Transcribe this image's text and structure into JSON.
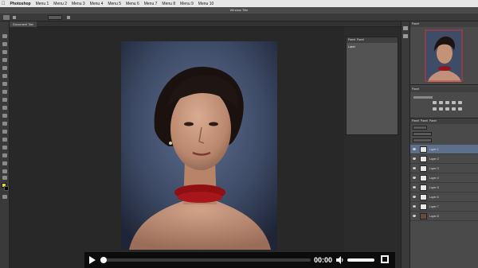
{
  "menubar": {
    "app": "Photoshop",
    "items": [
      "Menu 1",
      "Menu 2",
      "Menu 3",
      "Menu 4",
      "Menu 5",
      "Menu 6",
      "Menu 7",
      "Menu 8",
      "Menu 9",
      "Menu 10"
    ]
  },
  "titlebar": {
    "title": "Window Title"
  },
  "document": {
    "tab_label": "Document Tab"
  },
  "properties_panel": {
    "tabs": [
      "Panel",
      "Panel"
    ],
    "label": "Label"
  },
  "navigator_panel": {
    "tab_label": "Panel"
  },
  "adjustments_panel": {
    "tab_label": "Panel"
  },
  "layers_panel": {
    "tabs": [
      "Panel",
      "Panel",
      "Panel"
    ],
    "layers": [
      {
        "name": "Layer 1",
        "selected": true
      },
      {
        "name": "Layer 2",
        "selected": false
      },
      {
        "name": "Layer 3",
        "selected": false
      },
      {
        "name": "Layer 4",
        "selected": false
      },
      {
        "name": "Layer 5",
        "selected": false
      },
      {
        "name": "Layer 6",
        "selected": false
      },
      {
        "name": "Layer 7",
        "selected": false
      },
      {
        "name": "Layer 8",
        "selected": false
      }
    ]
  },
  "video": {
    "time": "00:00",
    "progress": 0.0,
    "volume": 1.0
  },
  "colors": {
    "foreground": "#e0e000",
    "background": "#000000",
    "accent": "#5d6f8a"
  }
}
